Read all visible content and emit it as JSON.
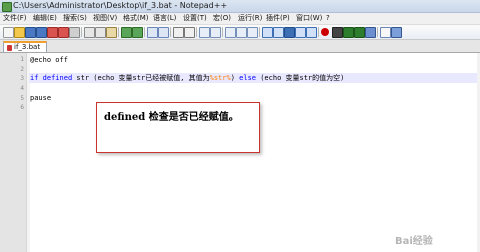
{
  "window": {
    "title": "C:\\Users\\Administrator\\Desktop\\if_3.bat - Notepad++"
  },
  "menu": [
    "文件(F)",
    "编辑(E)",
    "搜索(S)",
    "视图(V)",
    "格式(M)",
    "语言(L)",
    "设置(T)",
    "宏(O)",
    "运行(R)",
    "插件(P)",
    "窗口(W)",
    "?"
  ],
  "tab": {
    "label": "if_3.bat"
  },
  "editor": {
    "line_numbers": [
      "1",
      "2",
      "3",
      "4",
      "5",
      "6"
    ],
    "lines": {
      "l1": "@echo off",
      "l3_if": "if",
      "l3_defined": "defined",
      "l3_str": "str",
      "l3_mid": "(echo 变量str已经被赋值, 其值为",
      "l3_var": "%str%",
      "l3_close": ")",
      "l3_else": "else",
      "l3_tail": "(echo 变量str的值为空)",
      "l5": "pause"
    }
  },
  "annotation": {
    "text": "defined 检查是否已经赋值。"
  },
  "watermark": {
    "text": "Bai经验"
  }
}
